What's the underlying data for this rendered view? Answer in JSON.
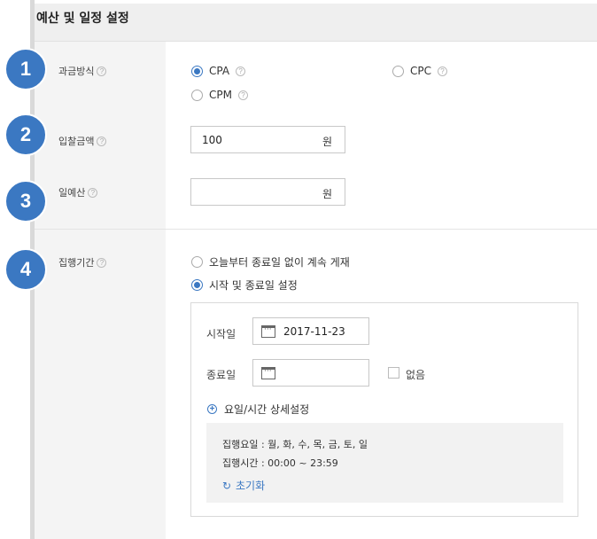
{
  "header": {
    "title": "예산 및 일정 설정"
  },
  "steps": [
    "1",
    "2",
    "3",
    "4"
  ],
  "billing": {
    "label": "과금방식",
    "options": [
      {
        "label": "CPA",
        "checked": true
      },
      {
        "label": "CPC",
        "checked": false
      },
      {
        "label": "CPM",
        "checked": false
      }
    ]
  },
  "bid": {
    "label": "입찰금액",
    "value": "100",
    "unit": "원"
  },
  "daily_budget": {
    "label": "일예산",
    "value": "",
    "unit": "원"
  },
  "period": {
    "label": "집행기간",
    "options": [
      {
        "label": "오늘부터 종료일 없이 계속 게재",
        "checked": false
      },
      {
        "label": "시작 및 종료일 설정",
        "checked": true
      }
    ],
    "start_label": "시작일",
    "start_value": "2017-11-23",
    "end_label": "종료일",
    "end_value": "",
    "none_label": "없음",
    "detail_label": "요일/시간 상세설정",
    "days_line": "집행요일 : 월, 화, 수, 목, 금, 토, 일",
    "time_line": "집행시간 : 00:00 ~ 23:59",
    "reset_label": "초기화"
  },
  "help_glyph": "?",
  "colors": {
    "accent": "#3b78c2",
    "label_bg": "#f4f4f4",
    "header_bg": "#efefef"
  }
}
